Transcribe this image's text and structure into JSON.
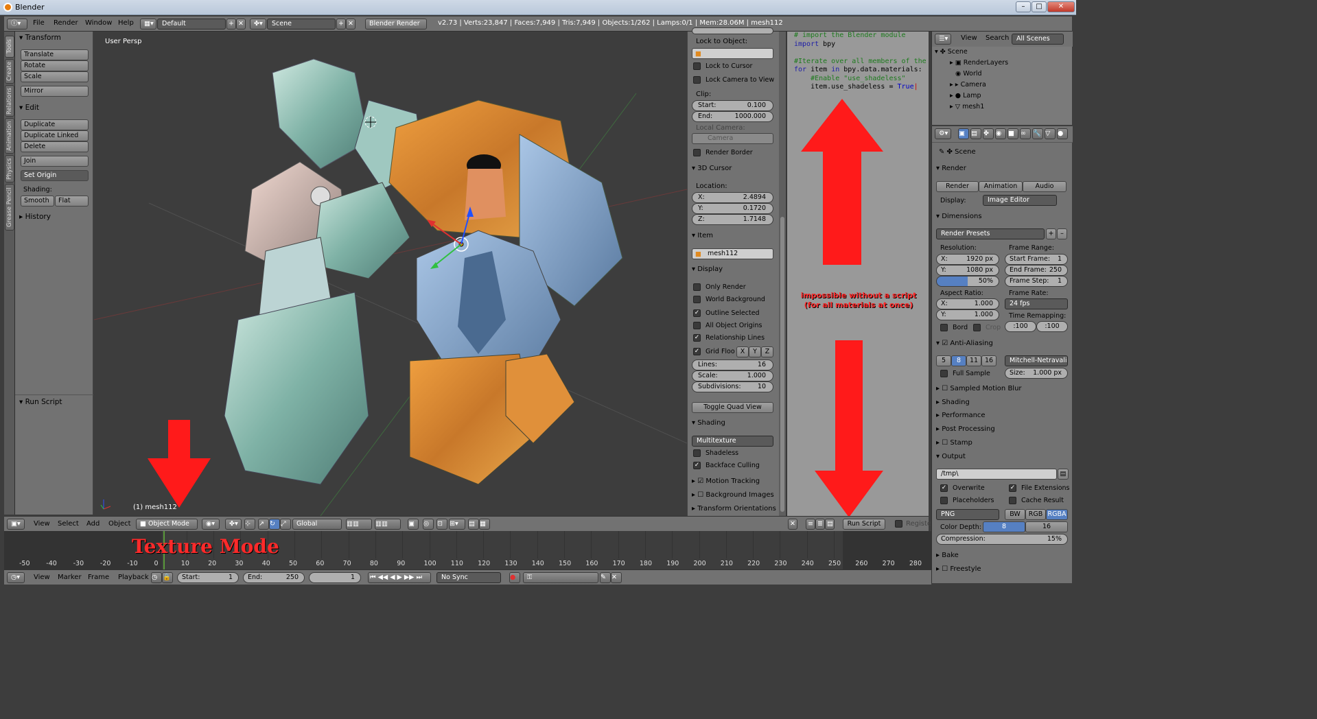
{
  "window": {
    "title": "Blender"
  },
  "info": {
    "menus": [
      "File",
      "Render",
      "Window",
      "Help"
    ],
    "layout": "Default",
    "scene": "Scene",
    "engine": "Blender Render",
    "stats": "v2.73 | Verts:23,847 | Faces:7,949 | Tris:7,949 | Objects:1/262 | Lamps:0/1 | Mem:28.06M | mesh112"
  },
  "tabs": [
    "Tools",
    "Create",
    "Relations",
    "Animation",
    "Physics",
    "Grease Pencil"
  ],
  "toolshelf": {
    "transform": "Transform",
    "translate": "Translate",
    "rotate": "Rotate",
    "scale": "Scale",
    "mirror": "Mirror",
    "edit": "Edit",
    "duplicate": "Duplicate",
    "duplicate_linked": "Duplicate Linked",
    "delete": "Delete",
    "join": "Join",
    "set_origin": "Set Origin",
    "shading": "Shading:",
    "smooth": "Smooth",
    "flat": "Flat",
    "history": "History",
    "run_script": "Run Script"
  },
  "viewport": {
    "title": "User Persp",
    "object": "(1) mesh112"
  },
  "npanel": {
    "lock_to_object": "Lock to Object:",
    "lock_cursor": "Lock to Cursor",
    "lock_camera": "Lock Camera to View",
    "clip": "Clip:",
    "clip_start_l": "Start:",
    "clip_start": "0.100",
    "clip_end_l": "End:",
    "clip_end": "1000.000",
    "local_camera": "Local Camera:",
    "camera": "Camera",
    "render_border": "Render Border",
    "cursor": "3D Cursor",
    "location": "Location:",
    "x_l": "X:",
    "x": "2.4894",
    "y_l": "Y:",
    "y": "0.1720",
    "z_l": "Z:",
    "z": "1.7148",
    "item": "Item",
    "item_name": "mesh112",
    "display": "Display",
    "only_render": "Only Render",
    "world_bg": "World Background",
    "outline_sel": "Outline Selected",
    "all_origins": "All Object Origins",
    "rel_lines": "Relationship Lines",
    "grid_floor": "Grid Floo",
    "gx": "X",
    "gy": "Y",
    "gz": "Z",
    "lines_l": "Lines:",
    "lines": "16",
    "scale_l": "Scale:",
    "scale": "1.000",
    "subdiv_l": "Subdivisions:",
    "subdiv": "10",
    "toggle_quad": "Toggle Quad View",
    "shading": "Shading",
    "multitexture": "Multitexture",
    "shadeless": "Shadeless",
    "backface": "Backface Culling",
    "motion_tracking": "Motion Tracking",
    "bg_images": "Background Images",
    "transform_orient": "Transform Orientations"
  },
  "code": {
    "l1": "# import the Blender module",
    "l2a": "import",
    "l2b": " bpy",
    "l3": "#Iterate over all members of the",
    "l4a": "for",
    "l4b": " item ",
    "l4c": "in",
    "l4d": " bpy.data.materials:",
    "l5": "    #Enable \"use_shadeless\"",
    "l6a": "    item.use_shadeless = ",
    "l6b": "True"
  },
  "texted": {
    "run_script": "Run Script",
    "register": "Register"
  },
  "annotations": {
    "impossible1": "impossible without a script",
    "impossible2": "(for all materials at once)",
    "texture_mode": "Texture Mode"
  },
  "outliner": {
    "view": "View",
    "search": "Search",
    "all_scenes": "All Scenes",
    "items": [
      "Scene",
      "RenderLayers",
      "World",
      "Camera",
      "Lamp",
      "mesh1"
    ]
  },
  "props": {
    "scene": "Scene",
    "render": "Render",
    "render_btn": "Render",
    "animation_btn": "Animation",
    "audio_btn": "Audio",
    "display_l": "Display:",
    "display": "Image Editor",
    "dimensions": "Dimensions",
    "presets": "Render Presets",
    "resolution": "Resolution:",
    "res_x_l": "X:",
    "res_x": "1920 px",
    "res_y_l": "Y:",
    "res_y": "1080 px",
    "res_pct": "50%",
    "frame_range": "Frame Range:",
    "start_frame_l": "Start Frame:",
    "start_frame": "1",
    "end_frame_l": "End Frame:",
    "end_frame": "250",
    "frame_step_l": "Frame Step:",
    "frame_step": "1",
    "aspect": "Aspect Ratio:",
    "asp_x_l": "X:",
    "asp_x": "1.000",
    "asp_y_l": "Y:",
    "asp_y": "1.000",
    "frame_rate": "Frame Rate:",
    "fps": "24 fps",
    "time_remap": "Time Remapping:",
    "remap_a": ":100",
    "remap_b": ":100",
    "bord": "Bord",
    "crop": "Crop",
    "aa": "Anti-Aliasing",
    "aa5": "5",
    "aa8": "8",
    "aa11": "11",
    "aa16": "16",
    "filter": "Mitchell-Netravali",
    "full_sample": "Full Sample",
    "size_l": "Size:",
    "size": "1.000 px",
    "motion_blur": "Sampled Motion Blur",
    "shading": "Shading",
    "performance": "Performance",
    "post": "Post Processing",
    "stamp": "Stamp",
    "output": "Output",
    "path": "/tmp\\",
    "overwrite": "Overwrite",
    "file_ext": "File Extensions",
    "placeholders": "Placeholders",
    "cache": "Cache Result",
    "format": "PNG",
    "bw": "BW",
    "rgb": "RGB",
    "rgba": "RGBA",
    "depth_l": "Color Depth:",
    "d8": "8",
    "d16": "16",
    "compression_l": "Compression:",
    "compression": "15%",
    "bake": "Bake",
    "freestyle": "Freestyle"
  },
  "vpheader": {
    "view": "View",
    "select": "Select",
    "add": "Add",
    "object": "Object",
    "mode": "Object Mode",
    "orientation": "Global"
  },
  "timeline": {
    "ticks": [
      "-50",
      "-40",
      "-30",
      "-20",
      "-10",
      "0",
      "10",
      "20",
      "30",
      "40",
      "50",
      "60",
      "70",
      "80",
      "90",
      "100",
      "110",
      "120",
      "130",
      "140",
      "150",
      "160",
      "170",
      "180",
      "190",
      "200",
      "210",
      "220",
      "230",
      "240",
      "250",
      "260",
      "270",
      "280"
    ],
    "view": "View",
    "marker": "Marker",
    "frame": "Frame",
    "playback": "Playback",
    "start_l": "Start:",
    "start": "1",
    "end_l": "End:",
    "end": "250",
    "current": "1",
    "sync": "No Sync"
  }
}
